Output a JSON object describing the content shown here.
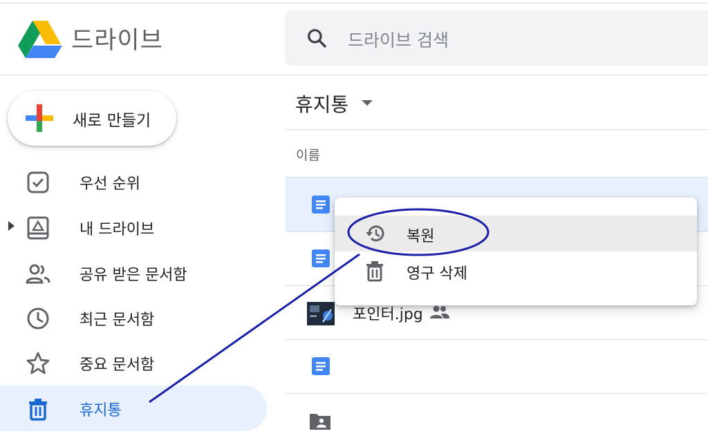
{
  "app": {
    "title": "드라이브"
  },
  "search": {
    "placeholder": "드라이브 검색"
  },
  "new_button": {
    "label": "새로 만들기"
  },
  "sidebar": {
    "items": [
      {
        "label": "우선 순위",
        "icon": "priority-check-icon"
      },
      {
        "label": "내 드라이브",
        "icon": "my-drive-icon"
      },
      {
        "label": "공유 받은 문서함",
        "icon": "people-icon"
      },
      {
        "label": "최근 문서함",
        "icon": "clock-icon"
      },
      {
        "label": "중요 문서함",
        "icon": "star-icon"
      },
      {
        "label": "휴지통",
        "icon": "trash-icon",
        "active": true
      }
    ]
  },
  "main": {
    "title": "휴지통",
    "column_header": "이름",
    "files": [
      {
        "name": "",
        "type": "doc",
        "selected": true
      },
      {
        "name": "",
        "type": "doc"
      },
      {
        "name": "포인터.jpg",
        "type": "image",
        "shared": true
      },
      {
        "name": "",
        "type": "doc"
      },
      {
        "name": "",
        "type": "shared-folder"
      }
    ]
  },
  "context_menu": {
    "items": [
      {
        "label": "복원",
        "icon": "restore-icon",
        "highlighted": true
      },
      {
        "label": "영구 삭제",
        "icon": "trash-icon"
      }
    ]
  },
  "colors": {
    "accent": "#1967d2",
    "active_bg": "#e8f0fe",
    "doc_blue": "#4285f4",
    "annotation": "#1a1fa8"
  }
}
